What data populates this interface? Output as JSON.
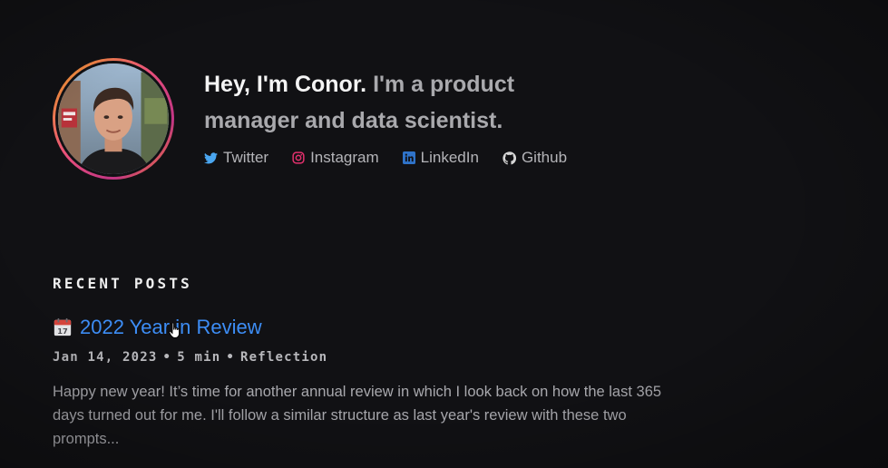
{
  "profile": {
    "intro_strong": "Hey, I'm Conor.",
    "intro_muted": "I'm a product manager and data scientist."
  },
  "social": [
    {
      "label": "Twitter",
      "icon": "twitter-icon",
      "color": "#4aa6f0"
    },
    {
      "label": "Instagram",
      "icon": "instagram-icon",
      "color": "#e1306c"
    },
    {
      "label": "LinkedIn",
      "icon": "linkedin-icon",
      "color": "#2f73c9"
    },
    {
      "label": "Github",
      "icon": "github-icon",
      "color": "#d6d6d6"
    }
  ],
  "recent_posts": {
    "heading": "RECENT POSTS",
    "posts": [
      {
        "emoji_icon": "calendar-icon",
        "title": "2022 Year in Review",
        "date": "Jan 14, 2023",
        "read_time": "5 min",
        "category": "Reflection",
        "excerpt": "Happy new year! It’s time for another annual review in which I look back on how the last 365 days turned out for me. I'll follow a similar structure as last year's review with these two prompts..."
      }
    ]
  },
  "colors": {
    "background": "#111114",
    "link": "#3d8df5",
    "text_muted": "#a9a9ad"
  }
}
